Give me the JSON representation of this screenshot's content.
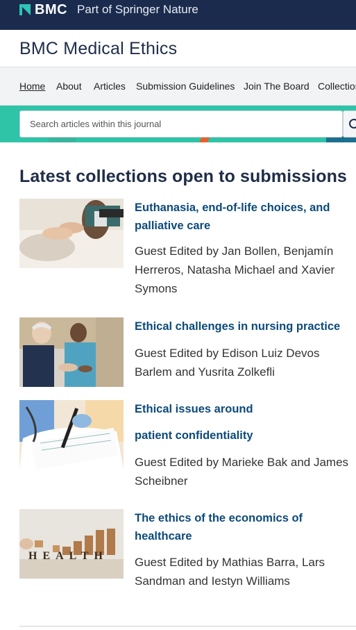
{
  "brand": {
    "name": "BMC",
    "tagline": "Part of Springer Nature"
  },
  "journal": {
    "title": "BMC Medical Ethics"
  },
  "nav": [
    {
      "label": "Home"
    },
    {
      "label": "About"
    },
    {
      "label": "Articles"
    },
    {
      "label": "Submission Guidelines"
    },
    {
      "label": "Join The Board"
    },
    {
      "label": "Collections"
    }
  ],
  "search": {
    "placeholder": "Search articles within this journal"
  },
  "section": {
    "title": "Latest collections open to submissions"
  },
  "collections": [
    {
      "title": "Euthanasia, end-of-life choices, and palliative care",
      "editors": "Guest Edited by Jan Bollen, Benjamín Herreros, Natasha Michael and Xavier Symons"
    },
    {
      "title": "Ethical challenges in nursing practice",
      "editors": "Guest Edited by Edison Luiz Devos Barlem and Yusrita Zolkefli"
    },
    {
      "title_line1": "Ethical issues around",
      "title_line2": "patient confidentiality",
      "editors": "Guest Edited by Marieke Bak and James Scheibner"
    },
    {
      "title": "The ethics of the economics of healthcare",
      "editors": "Guest Edited by Mathias Barra, Lars Sandman and Iestyn Williams",
      "thumb_text": "HEALTH"
    }
  ],
  "colors": {
    "topbar": "#1a2b4d",
    "accent": "#2fc4a8",
    "link": "#0c4a7a",
    "heading": "#1f2d48"
  }
}
